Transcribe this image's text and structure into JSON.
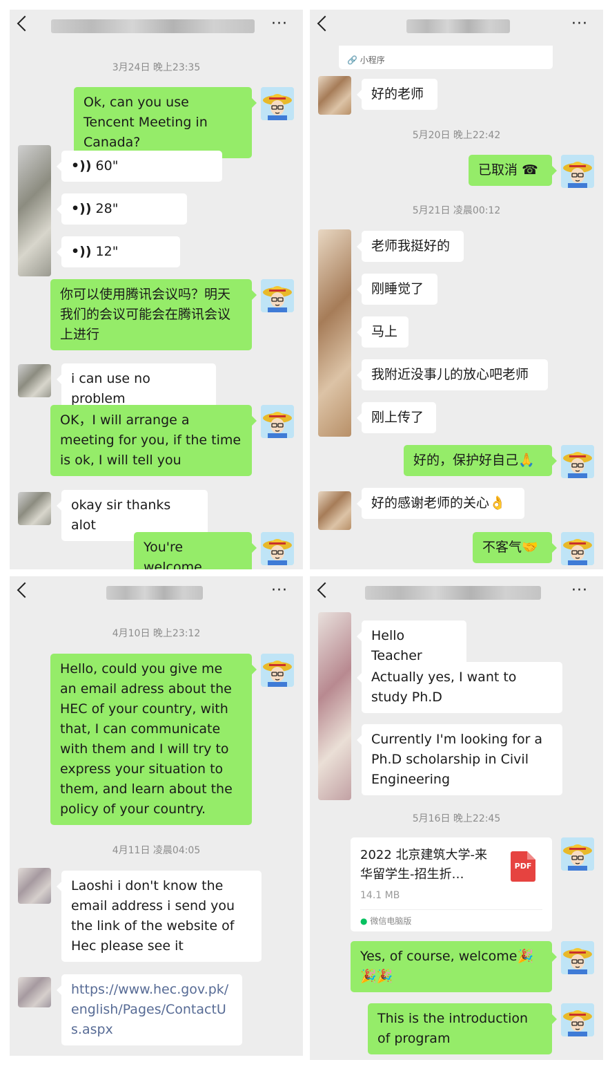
{
  "ui": {
    "more": "···",
    "pdf": "PDF"
  },
  "p1": {
    "timestamp": "3月24日 晚上23:35",
    "m1": "Ok, can you use Tencent Meeting in Canada?",
    "v1": "60\"",
    "v2": "28\"",
    "v3": "12\"",
    "m2": "你可以使用腾讯会议吗？明天我们的会议可能会在腾讯会议上进行",
    "m3": "i can use no problem",
    "m4": "OK，I will arrange a meeting for you, if the time is ok, I will tell you",
    "m5": "okay sir thanks alot",
    "m6": "You're welcome"
  },
  "p2": {
    "miniprogram": "小程序",
    "m1": "好的老师",
    "ts1": "5月20日 晚上22:42",
    "m2": "已取消",
    "ts2": "5月21日 凌晨00:12",
    "m3": "老师我挺好的",
    "m4": "刚睡觉了",
    "m5": "马上",
    "m6": "我附近没事儿的放心吧老师",
    "m7": "刚上传了",
    "m8": "好的，保护好自己🙏",
    "m9": "好的感谢老师的关心👌",
    "m10": "不客气🤝"
  },
  "p3": {
    "ts1": "4月10日 晚上23:12",
    "m1": "Hello, could you give me an email adress about the HEC of your country, with that, I can communicate with them and I will try to express your   situation to them, and learn about the policy of your country.",
    "ts2": "4月11日 凌晨04:05",
    "m2": "Laoshi i don't know the email address i send you the link of the website of Hec please see it",
    "m3": "https://www.hec.gov.pk/english/Pages/ContactUs.aspx"
  },
  "p4": {
    "m1": "Hello Teacher",
    "m2": "Actually yes, I want to study Ph.D",
    "m3": "Currently I'm looking for a Ph.D scholarship in Civil Engineering",
    "ts": "5月16日 晚上22:45",
    "file_name": "2022 北京建筑大学-来华留学生-招生折…",
    "file_size": "14.1 MB",
    "file_source": "微信电脑版",
    "m4": "Yes, of course, welcome🎉🎉🎉",
    "m5": "This is the introduction of program"
  }
}
